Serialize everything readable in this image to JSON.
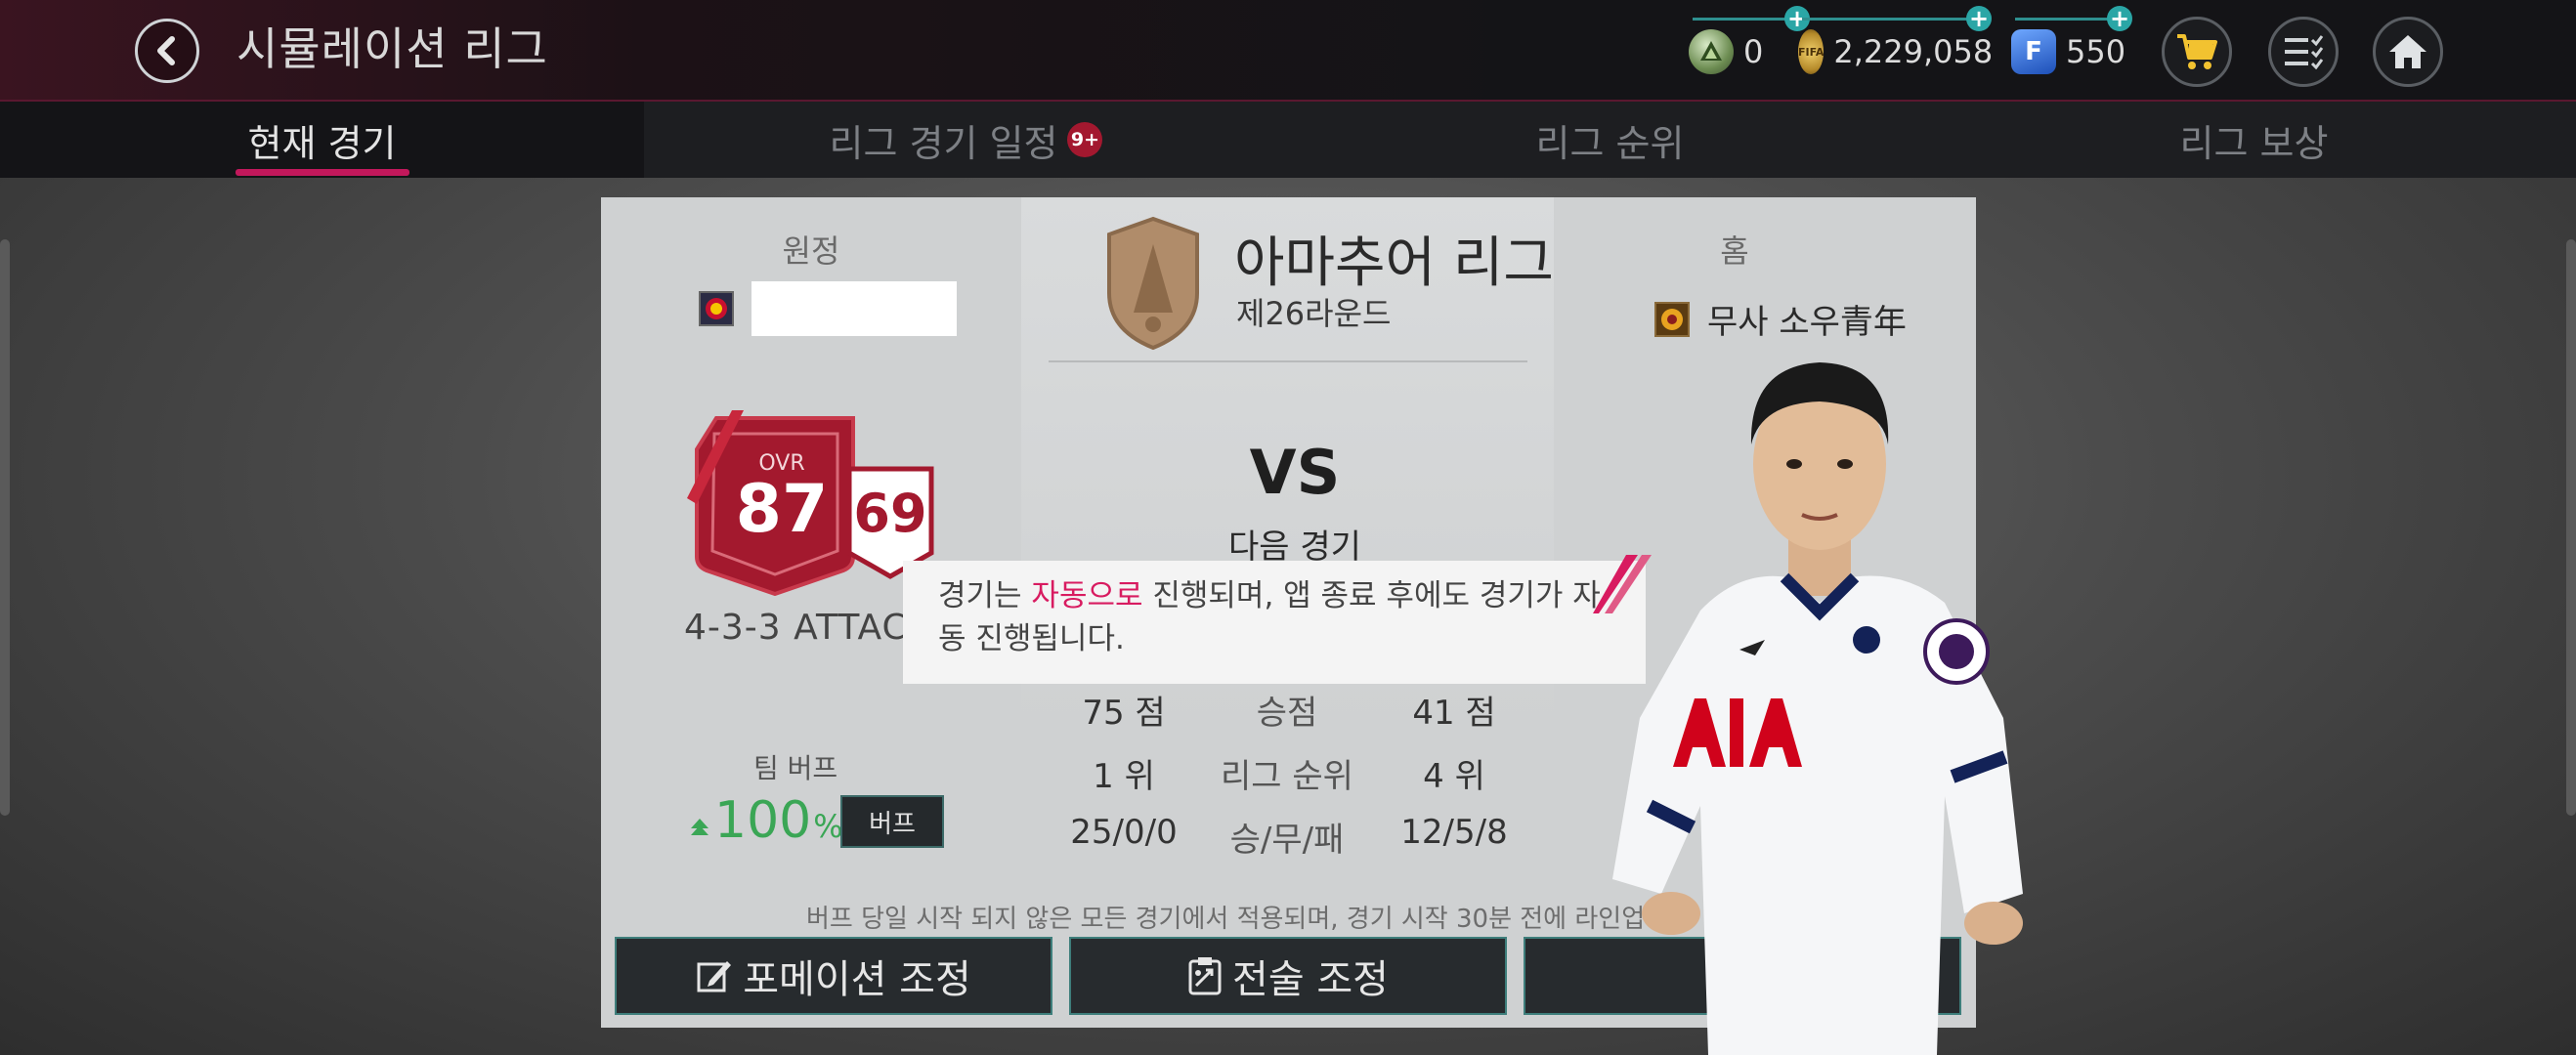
{
  "header": {
    "title": "시뮬레이션 리그",
    "currencies": [
      {
        "icon": "green-token-icon",
        "value": "0"
      },
      {
        "icon": "fifa-coin-icon",
        "value": "2,229,058"
      },
      {
        "icon": "fifa-point-icon",
        "value": "550"
      }
    ],
    "coin_label": "FIFA",
    "point_label": "F"
  },
  "tabs": [
    {
      "label": "현재 경기",
      "active": true
    },
    {
      "label": "리그 경기 일정",
      "badge": "9+"
    },
    {
      "label": "리그 순위"
    },
    {
      "label": "리그 보상"
    }
  ],
  "match": {
    "away_label": "원정",
    "home_label": "홈",
    "home_team": "무사 소우青年",
    "league": "아마추어 리그",
    "round": "제26라운드",
    "vs": "VS",
    "next_match": "다음 경기",
    "ovr_label": "OVR",
    "ovr": "87",
    "secondary_rating": "69",
    "formation": "4-3-3 ATTAC",
    "stats": {
      "left": [
        "75 점",
        "1 위",
        "25/0/0"
      ],
      "labels": [
        "승점",
        "리그 순위",
        "승/무/패"
      ],
      "right": [
        "41 점",
        "4 위",
        "12/5/8"
      ]
    },
    "team_buff_label": "팀 버프",
    "team_buff_value": "100",
    "team_buff_unit": "%",
    "buff_button": "버프",
    "note": "버프 당일 시작 되지 않은 모든 경기에서 적용되며, 경기 시작 30분 전에 라인업"
  },
  "tooltip": {
    "prefix": "경기는 ",
    "highlight": "자동으로",
    "suffix": " 진행되며, 앱 종료 후에도 경기가 자동 진행됩니다."
  },
  "buttons": {
    "formation": "포메이션 조정",
    "tactics": "전술 조정"
  },
  "colors": {
    "accent": "#c2185b",
    "teal": "#2aa6a6",
    "buff_green": "#3aa655",
    "card_red": "#a3192e"
  }
}
